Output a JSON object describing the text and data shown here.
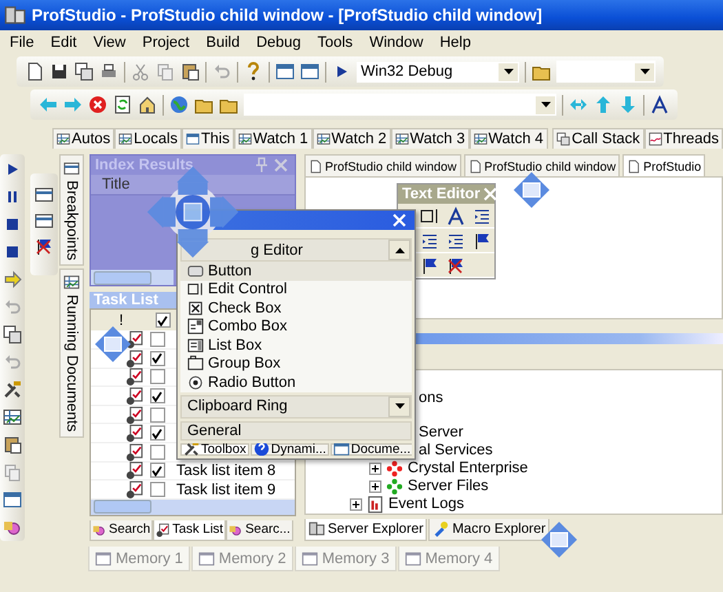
{
  "window": {
    "title": "ProfStudio - ProfStudio child window - [ProfStudio child window]"
  },
  "menu": [
    "File",
    "Edit",
    "View",
    "Project",
    "Build",
    "Debug",
    "Tools",
    "Window",
    "Help"
  ],
  "toolbar": {
    "configuration": "Win32 Debug"
  },
  "debug_tabs": [
    {
      "label": "Autos",
      "selected": false
    },
    {
      "label": "Locals",
      "selected": false
    },
    {
      "label": "This",
      "selected": false
    },
    {
      "label": "Watch 1",
      "selected": false
    },
    {
      "label": "Watch 2",
      "selected": false
    },
    {
      "label": "Watch 3",
      "selected": false
    },
    {
      "label": "Watch 4",
      "selected": false
    },
    {
      "label": "Call Stack",
      "selected": false
    },
    {
      "label": "Threads",
      "selected": false
    }
  ],
  "side_tabs": [
    {
      "label": "Breakpoints",
      "selected": false
    },
    {
      "label": "Running Documents",
      "selected": false
    }
  ],
  "index_results": {
    "title": "Index Results",
    "columns": [
      "Title"
    ]
  },
  "task_list": {
    "title": "Task List",
    "header": "!",
    "rows": [
      {
        "checked": false
      },
      {
        "checked": true
      },
      {
        "checked": false
      },
      {
        "checked": true
      },
      {
        "checked": false
      },
      {
        "checked": true
      },
      {
        "checked": false
      },
      {
        "checked": true,
        "label": "Task list item 8"
      },
      {
        "checked": false,
        "label": "Task list item 9"
      }
    ]
  },
  "left_tabs": [
    {
      "label": "Search",
      "selected": false
    },
    {
      "label": "Task List",
      "selected": true
    },
    {
      "label": "Searc...",
      "selected": false
    }
  ],
  "documents": [
    {
      "label": "ProfStudio child window",
      "selected": false
    },
    {
      "label": "ProfStudio child window",
      "selected": false
    },
    {
      "label": "ProfStudio",
      "selected": true
    }
  ],
  "text_editor": {
    "title": "Text Editor"
  },
  "toolbox": {
    "group": "g Editor",
    "items": [
      {
        "label": "Button",
        "kind": "button"
      },
      {
        "label": "Edit Control",
        "kind": "edit"
      },
      {
        "label": "Check Box",
        "kind": "check"
      },
      {
        "label": "Combo Box",
        "kind": "combo"
      },
      {
        "label": "List Box",
        "kind": "list"
      },
      {
        "label": "Group Box",
        "kind": "group"
      },
      {
        "label": "Radio Button",
        "kind": "radio"
      }
    ],
    "groups": [
      "Clipboard Ring",
      "General"
    ],
    "tabs": [
      {
        "label": "Toolbox",
        "selected": true
      },
      {
        "label": "Dynami...",
        "selected": false
      },
      {
        "label": "Docume...",
        "selected": false
      }
    ]
  },
  "server_tree": [
    {
      "label": "ons"
    },
    {
      "label": "Server",
      "children": [
        {
          "label": "al Services",
          "children": [
            {
              "label": "Crystal Enterprise",
              "kind": "enterprise",
              "expanded": false
            },
            {
              "label": "Server Files",
              "kind": "files",
              "expanded": false
            }
          ]
        },
        {
          "label": "Event Logs",
          "kind": "logs",
          "expanded": false
        }
      ]
    }
  ],
  "right_tabs": [
    {
      "label": "Server Explorer",
      "selected": true
    },
    {
      "label": "Macro Explorer",
      "selected": false
    }
  ],
  "memory_tabs": [
    {
      "label": "Memory 1",
      "selected": false
    },
    {
      "label": "Memory 2",
      "selected": false
    },
    {
      "label": "Memory 3",
      "selected": false
    },
    {
      "label": "Memory 4",
      "selected": false
    }
  ]
}
